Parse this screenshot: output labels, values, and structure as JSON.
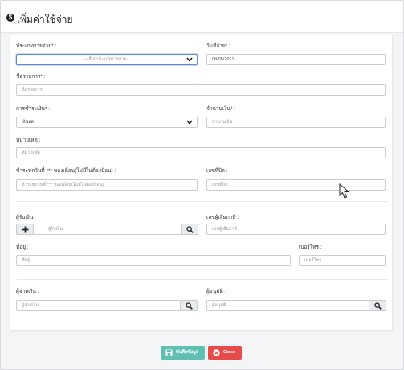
{
  "modal": {
    "title": "เพิ่มค่าใช้จ่าย"
  },
  "form": {
    "expense_type": {
      "label": "ประเภทรายจ่าย* :",
      "value": "--เลือกประเภทรายจ่าย--"
    },
    "pay_date": {
      "label": "วันที่จ่าย* :",
      "value": "08/05/2021"
    },
    "item_name": {
      "label": "ชื่อรายการ* :",
      "placeholder": "ชื่อรายการ"
    },
    "payment": {
      "label": "การชำระเงิน* :",
      "value": "เงินสด"
    },
    "amount": {
      "label": "จำนวนเงิน* :",
      "placeholder": "จำนวนเงิน"
    },
    "note": {
      "label": "หมายเหตุ :",
      "placeholder": "หมายเหตุ"
    },
    "pay_every": {
      "label": "ชำระทุกวันที่ *** ของเดือน(ไม่มีไม่ต้องป้อน) :",
      "placeholder": "ชำระทุกวันที่ *** ของเดือน(ไม่มีไม่ต้องป้อน)"
    },
    "bill_no": {
      "label": "เลขที่บิล :",
      "placeholder": "เลขที่บิล"
    },
    "payee": {
      "label": "ผู้รับเงิน :",
      "placeholder": "ผู้รับเงิน"
    },
    "tax_id": {
      "label": "เลขผู้เสียภาษี :",
      "placeholder": "เลขผู้เสียภาษี"
    },
    "address": {
      "label": "ที่อยู่ :",
      "placeholder": "ที่อยู่"
    },
    "phone": {
      "label": "เบอร์โทร :",
      "placeholder": "เบอร์โทร"
    },
    "payer": {
      "label": "ผู้จ่ายเงิน :",
      "placeholder": "ผู้จ่ายเงิน"
    },
    "approver": {
      "label": "ผู้อนุมัติ :",
      "placeholder": "ผู้อนุมัติ"
    }
  },
  "buttons": {
    "save": "บันทึกข้อมูล",
    "close": "Close"
  },
  "colors": {
    "save": "#5fbfb3",
    "close": "#e74c4c",
    "focus": "#5b8ad8"
  }
}
